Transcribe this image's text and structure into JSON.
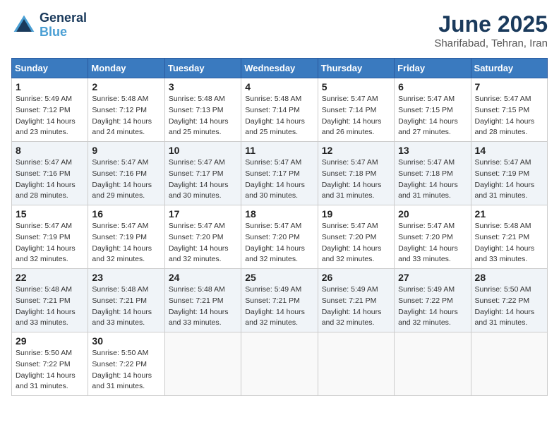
{
  "header": {
    "logo_line1": "General",
    "logo_line2": "Blue",
    "month": "June 2025",
    "location": "Sharifabad, Tehran, Iran"
  },
  "weekdays": [
    "Sunday",
    "Monday",
    "Tuesday",
    "Wednesday",
    "Thursday",
    "Friday",
    "Saturday"
  ],
  "weeks": [
    [
      {
        "day": 1,
        "sunrise": "5:49 AM",
        "sunset": "7:12 PM",
        "daylight": "14 hours and 23 minutes."
      },
      {
        "day": 2,
        "sunrise": "5:48 AM",
        "sunset": "7:12 PM",
        "daylight": "14 hours and 24 minutes."
      },
      {
        "day": 3,
        "sunrise": "5:48 AM",
        "sunset": "7:13 PM",
        "daylight": "14 hours and 25 minutes."
      },
      {
        "day": 4,
        "sunrise": "5:48 AM",
        "sunset": "7:14 PM",
        "daylight": "14 hours and 25 minutes."
      },
      {
        "day": 5,
        "sunrise": "5:47 AM",
        "sunset": "7:14 PM",
        "daylight": "14 hours and 26 minutes."
      },
      {
        "day": 6,
        "sunrise": "5:47 AM",
        "sunset": "7:15 PM",
        "daylight": "14 hours and 27 minutes."
      },
      {
        "day": 7,
        "sunrise": "5:47 AM",
        "sunset": "7:15 PM",
        "daylight": "14 hours and 28 minutes."
      }
    ],
    [
      {
        "day": 8,
        "sunrise": "5:47 AM",
        "sunset": "7:16 PM",
        "daylight": "14 hours and 28 minutes."
      },
      {
        "day": 9,
        "sunrise": "5:47 AM",
        "sunset": "7:16 PM",
        "daylight": "14 hours and 29 minutes."
      },
      {
        "day": 10,
        "sunrise": "5:47 AM",
        "sunset": "7:17 PM",
        "daylight": "14 hours and 30 minutes."
      },
      {
        "day": 11,
        "sunrise": "5:47 AM",
        "sunset": "7:17 PM",
        "daylight": "14 hours and 30 minutes."
      },
      {
        "day": 12,
        "sunrise": "5:47 AM",
        "sunset": "7:18 PM",
        "daylight": "14 hours and 31 minutes."
      },
      {
        "day": 13,
        "sunrise": "5:47 AM",
        "sunset": "7:18 PM",
        "daylight": "14 hours and 31 minutes."
      },
      {
        "day": 14,
        "sunrise": "5:47 AM",
        "sunset": "7:19 PM",
        "daylight": "14 hours and 31 minutes."
      }
    ],
    [
      {
        "day": 15,
        "sunrise": "5:47 AM",
        "sunset": "7:19 PM",
        "daylight": "14 hours and 32 minutes."
      },
      {
        "day": 16,
        "sunrise": "5:47 AM",
        "sunset": "7:19 PM",
        "daylight": "14 hours and 32 minutes."
      },
      {
        "day": 17,
        "sunrise": "5:47 AM",
        "sunset": "7:20 PM",
        "daylight": "14 hours and 32 minutes."
      },
      {
        "day": 18,
        "sunrise": "5:47 AM",
        "sunset": "7:20 PM",
        "daylight": "14 hours and 32 minutes."
      },
      {
        "day": 19,
        "sunrise": "5:47 AM",
        "sunset": "7:20 PM",
        "daylight": "14 hours and 32 minutes."
      },
      {
        "day": 20,
        "sunrise": "5:47 AM",
        "sunset": "7:20 PM",
        "daylight": "14 hours and 33 minutes."
      },
      {
        "day": 21,
        "sunrise": "5:48 AM",
        "sunset": "7:21 PM",
        "daylight": "14 hours and 33 minutes."
      }
    ],
    [
      {
        "day": 22,
        "sunrise": "5:48 AM",
        "sunset": "7:21 PM",
        "daylight": "14 hours and 33 minutes."
      },
      {
        "day": 23,
        "sunrise": "5:48 AM",
        "sunset": "7:21 PM",
        "daylight": "14 hours and 33 minutes."
      },
      {
        "day": 24,
        "sunrise": "5:48 AM",
        "sunset": "7:21 PM",
        "daylight": "14 hours and 33 minutes."
      },
      {
        "day": 25,
        "sunrise": "5:49 AM",
        "sunset": "7:21 PM",
        "daylight": "14 hours and 32 minutes."
      },
      {
        "day": 26,
        "sunrise": "5:49 AM",
        "sunset": "7:21 PM",
        "daylight": "14 hours and 32 minutes."
      },
      {
        "day": 27,
        "sunrise": "5:49 AM",
        "sunset": "7:22 PM",
        "daylight": "14 hours and 32 minutes."
      },
      {
        "day": 28,
        "sunrise": "5:50 AM",
        "sunset": "7:22 PM",
        "daylight": "14 hours and 31 minutes."
      }
    ],
    [
      {
        "day": 29,
        "sunrise": "5:50 AM",
        "sunset": "7:22 PM",
        "daylight": "14 hours and 31 minutes."
      },
      {
        "day": 30,
        "sunrise": "5:50 AM",
        "sunset": "7:22 PM",
        "daylight": "14 hours and 31 minutes."
      },
      null,
      null,
      null,
      null,
      null
    ]
  ]
}
